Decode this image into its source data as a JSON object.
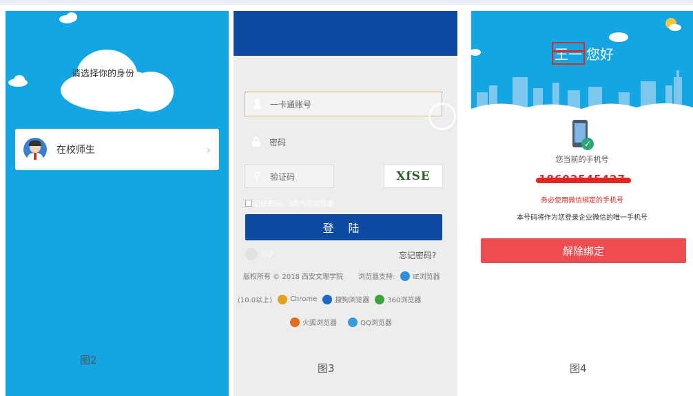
{
  "panel_identity": {
    "prompt": "请选择你的身份",
    "identity_option": "在校师生",
    "chevron": "›",
    "caption": "图2"
  },
  "panel_login": {
    "account_placeholder": "一卡通账号",
    "password_placeholder": "密码",
    "captcha_placeholder": "验证码",
    "captcha_text": "XfSE",
    "remember_text": "记住密码，3周内自动登录",
    "login_button": "登 陆",
    "qq_label": "QQ",
    "forgot_password": "忘记密码?",
    "copyright": "版权所有 © 2018 西安文理学院",
    "browser_support_label": "浏览器支持:",
    "browsers_line1": [
      "IE浏览器"
    ],
    "ie_version": "(10.0以上)",
    "browsers_line2": [
      "Chrome",
      "搜狗浏览器",
      "360浏览器"
    ],
    "browsers_line3": [
      "火狐浏览器",
      "QQ浏览器"
    ],
    "caption": "图3",
    "colors": {
      "header": "#0b4aa1",
      "accent_border": "#e3b45a"
    }
  },
  "panel_unbind": {
    "greeting_name": "王一",
    "greeting_suffix": "您好",
    "current_phone_label": "您当前的手机号",
    "phone_number": "18602545427",
    "bind_notice": "务必使用微信绑定的手机号",
    "note": "本号码将作为您登录企业微信的唯一手机号",
    "unbind_button": "解除绑定",
    "caption": "图4",
    "colors": {
      "button": "#ee4d51",
      "sky": "#14a6e2"
    }
  }
}
